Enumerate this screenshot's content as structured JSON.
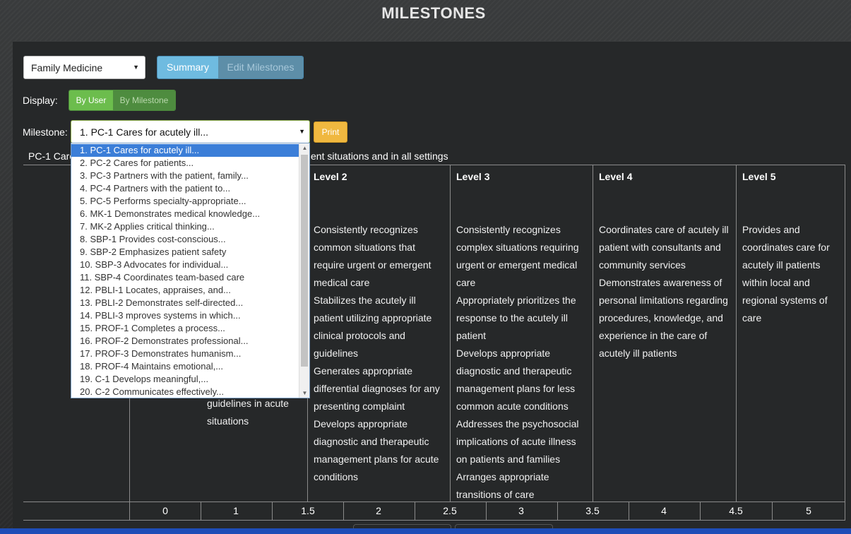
{
  "page": {
    "title": "MILESTONES"
  },
  "controls": {
    "program": "Family Medicine",
    "view_tabs": [
      "Summary",
      "Edit Milestones"
    ],
    "display_label": "Display:",
    "display_toggle": [
      "By User",
      "By Milestone"
    ],
    "milestone_label": "Milestone:",
    "milestone_selected": "1. PC-1 Cares for acutely ill...",
    "print_label": "Print"
  },
  "milestone_heading": {
    "left_fragment": "PC-1 Care",
    "right_fragment": "ent situations and in all settings"
  },
  "dropdown": {
    "items": [
      "1. PC-1 Cares for acutely ill...",
      "2. PC-2 Cares for patients...",
      "3. PC-3 Partners with the patient, family...",
      "4. PC-4 Partners with the patient to...",
      "5. PC-5 Performs specialty-appropriate...",
      "6. MK-1 Demonstrates medical knowledge...",
      "7. MK-2 Applies critical thinking...",
      "8. SBP-1 Provides cost-conscious...",
      "9. SBP-2 Emphasizes patient safety",
      "10. SBP-3 Advocates for individual...",
      "11. SBP-4 Coordinates team-based care",
      "12. PBLI-1 Locates, appraises, and...",
      "13. PBLI-2 Demonstrates self-directed...",
      "14. PBLI-3 mproves systems in which...",
      "15. PROF-1 Completes a process...",
      "16. PROF-2 Demonstrates professional...",
      "17. PROF-3 Demonstrates humanism...",
      "18. PROF-4 Maintains emotional,...",
      "19. C-1 Develops meaningful,...",
      "20. C-2 Communicates effectively..."
    ]
  },
  "levels": [
    {
      "title": "Level 2",
      "text": [
        "Consistently recognizes",
        "common situations that",
        "require urgent or emergent",
        "medical care",
        "Stabilizes the acutely ill",
        "patient utilizing appropriate",
        "clinical protocols and",
        "guidelines",
        "Generates appropriate",
        "differential diagnoses for any",
        "presenting complaint",
        "Develops appropriate",
        "diagnostic and therapeutic",
        "management plans for acute",
        "conditions"
      ]
    },
    {
      "title": "Level 3",
      "text": [
        "Consistently recognizes",
        "complex situations requiring",
        "urgent or emergent medical",
        "care",
        "Appropriately prioritizes the",
        "response to the acutely ill",
        "patient",
        "Develops appropriate",
        "diagnostic and therapeutic",
        "management plans for less",
        "common acute conditions",
        "Addresses the psychosocial",
        "implications of acute illness",
        "on patients and families",
        "Arranges appropriate",
        "transitions of care"
      ]
    },
    {
      "title": "Level 4",
      "text": [
        "Coordinates care of acutely ill",
        "patient with consultants and",
        "community services",
        "Demonstrates awareness of",
        "personal limitations regarding",
        "procedures, knowledge, and",
        "experience in the care of",
        "acutely ill patients"
      ]
    },
    {
      "title": "Level 5",
      "text": [
        "Provides and",
        "coordinates care for",
        "acutely ill patients",
        "within local and",
        "regional systems of",
        "care"
      ]
    }
  ],
  "level1_tail": [
    "guidelines in acute",
    "situations"
  ],
  "scale": [
    "0",
    "1",
    "1.5",
    "2",
    "2.5",
    "3",
    "3.5",
    "4",
    "4.5",
    "5"
  ]
}
